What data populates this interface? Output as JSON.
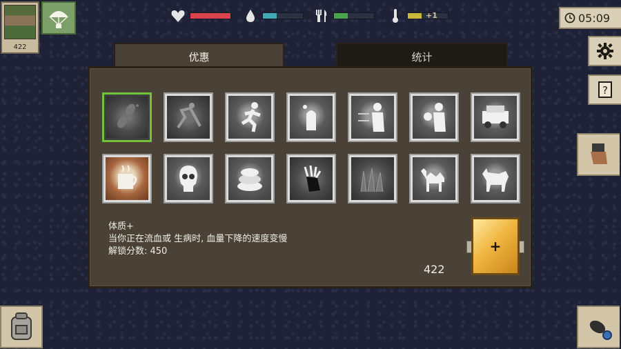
{
  "hud": {
    "avatar_count": "422",
    "timer": "05:09",
    "stats": [
      {
        "name": "health",
        "icon": "heart-icon",
        "level": 1.0,
        "color": "#d9434e"
      },
      {
        "name": "water",
        "icon": "water-drop-icon",
        "level": 0.35,
        "color": "#3fa9b5"
      },
      {
        "name": "food",
        "icon": "fork-knife-icon",
        "level": 0.35,
        "color": "#4aa34e"
      },
      {
        "name": "temperature",
        "icon": "thermometer-icon",
        "level": 0.35,
        "color": "#c9b83a",
        "text": "+1"
      }
    ]
  },
  "tabs": [
    {
      "label": "优惠",
      "active": true
    },
    {
      "label": "统计",
      "active": false
    }
  ],
  "perks": [
    {
      "name": "footprints",
      "selected": true
    },
    {
      "name": "running-man-faded",
      "selected": false
    },
    {
      "name": "sprinter",
      "selected": false
    },
    {
      "name": "vision",
      "selected": false
    },
    {
      "name": "strongman-wind",
      "selected": false
    },
    {
      "name": "boxer",
      "selected": false
    },
    {
      "name": "truck",
      "selected": false
    },
    {
      "name": "hot-drink",
      "selected": false
    },
    {
      "name": "skull",
      "selected": false
    },
    {
      "name": "bread",
      "selected": false
    },
    {
      "name": "claw-hand",
      "selected": false
    },
    {
      "name": "spikes",
      "selected": false
    },
    {
      "name": "camel",
      "selected": false
    },
    {
      "name": "wolf",
      "selected": false
    }
  ],
  "description": {
    "title": "体质+",
    "text": "当你正在流血或 生病时, 血量下降的速度变慢",
    "unlock": "解锁分数:  450"
  },
  "points": "422",
  "plus_label": "+"
}
